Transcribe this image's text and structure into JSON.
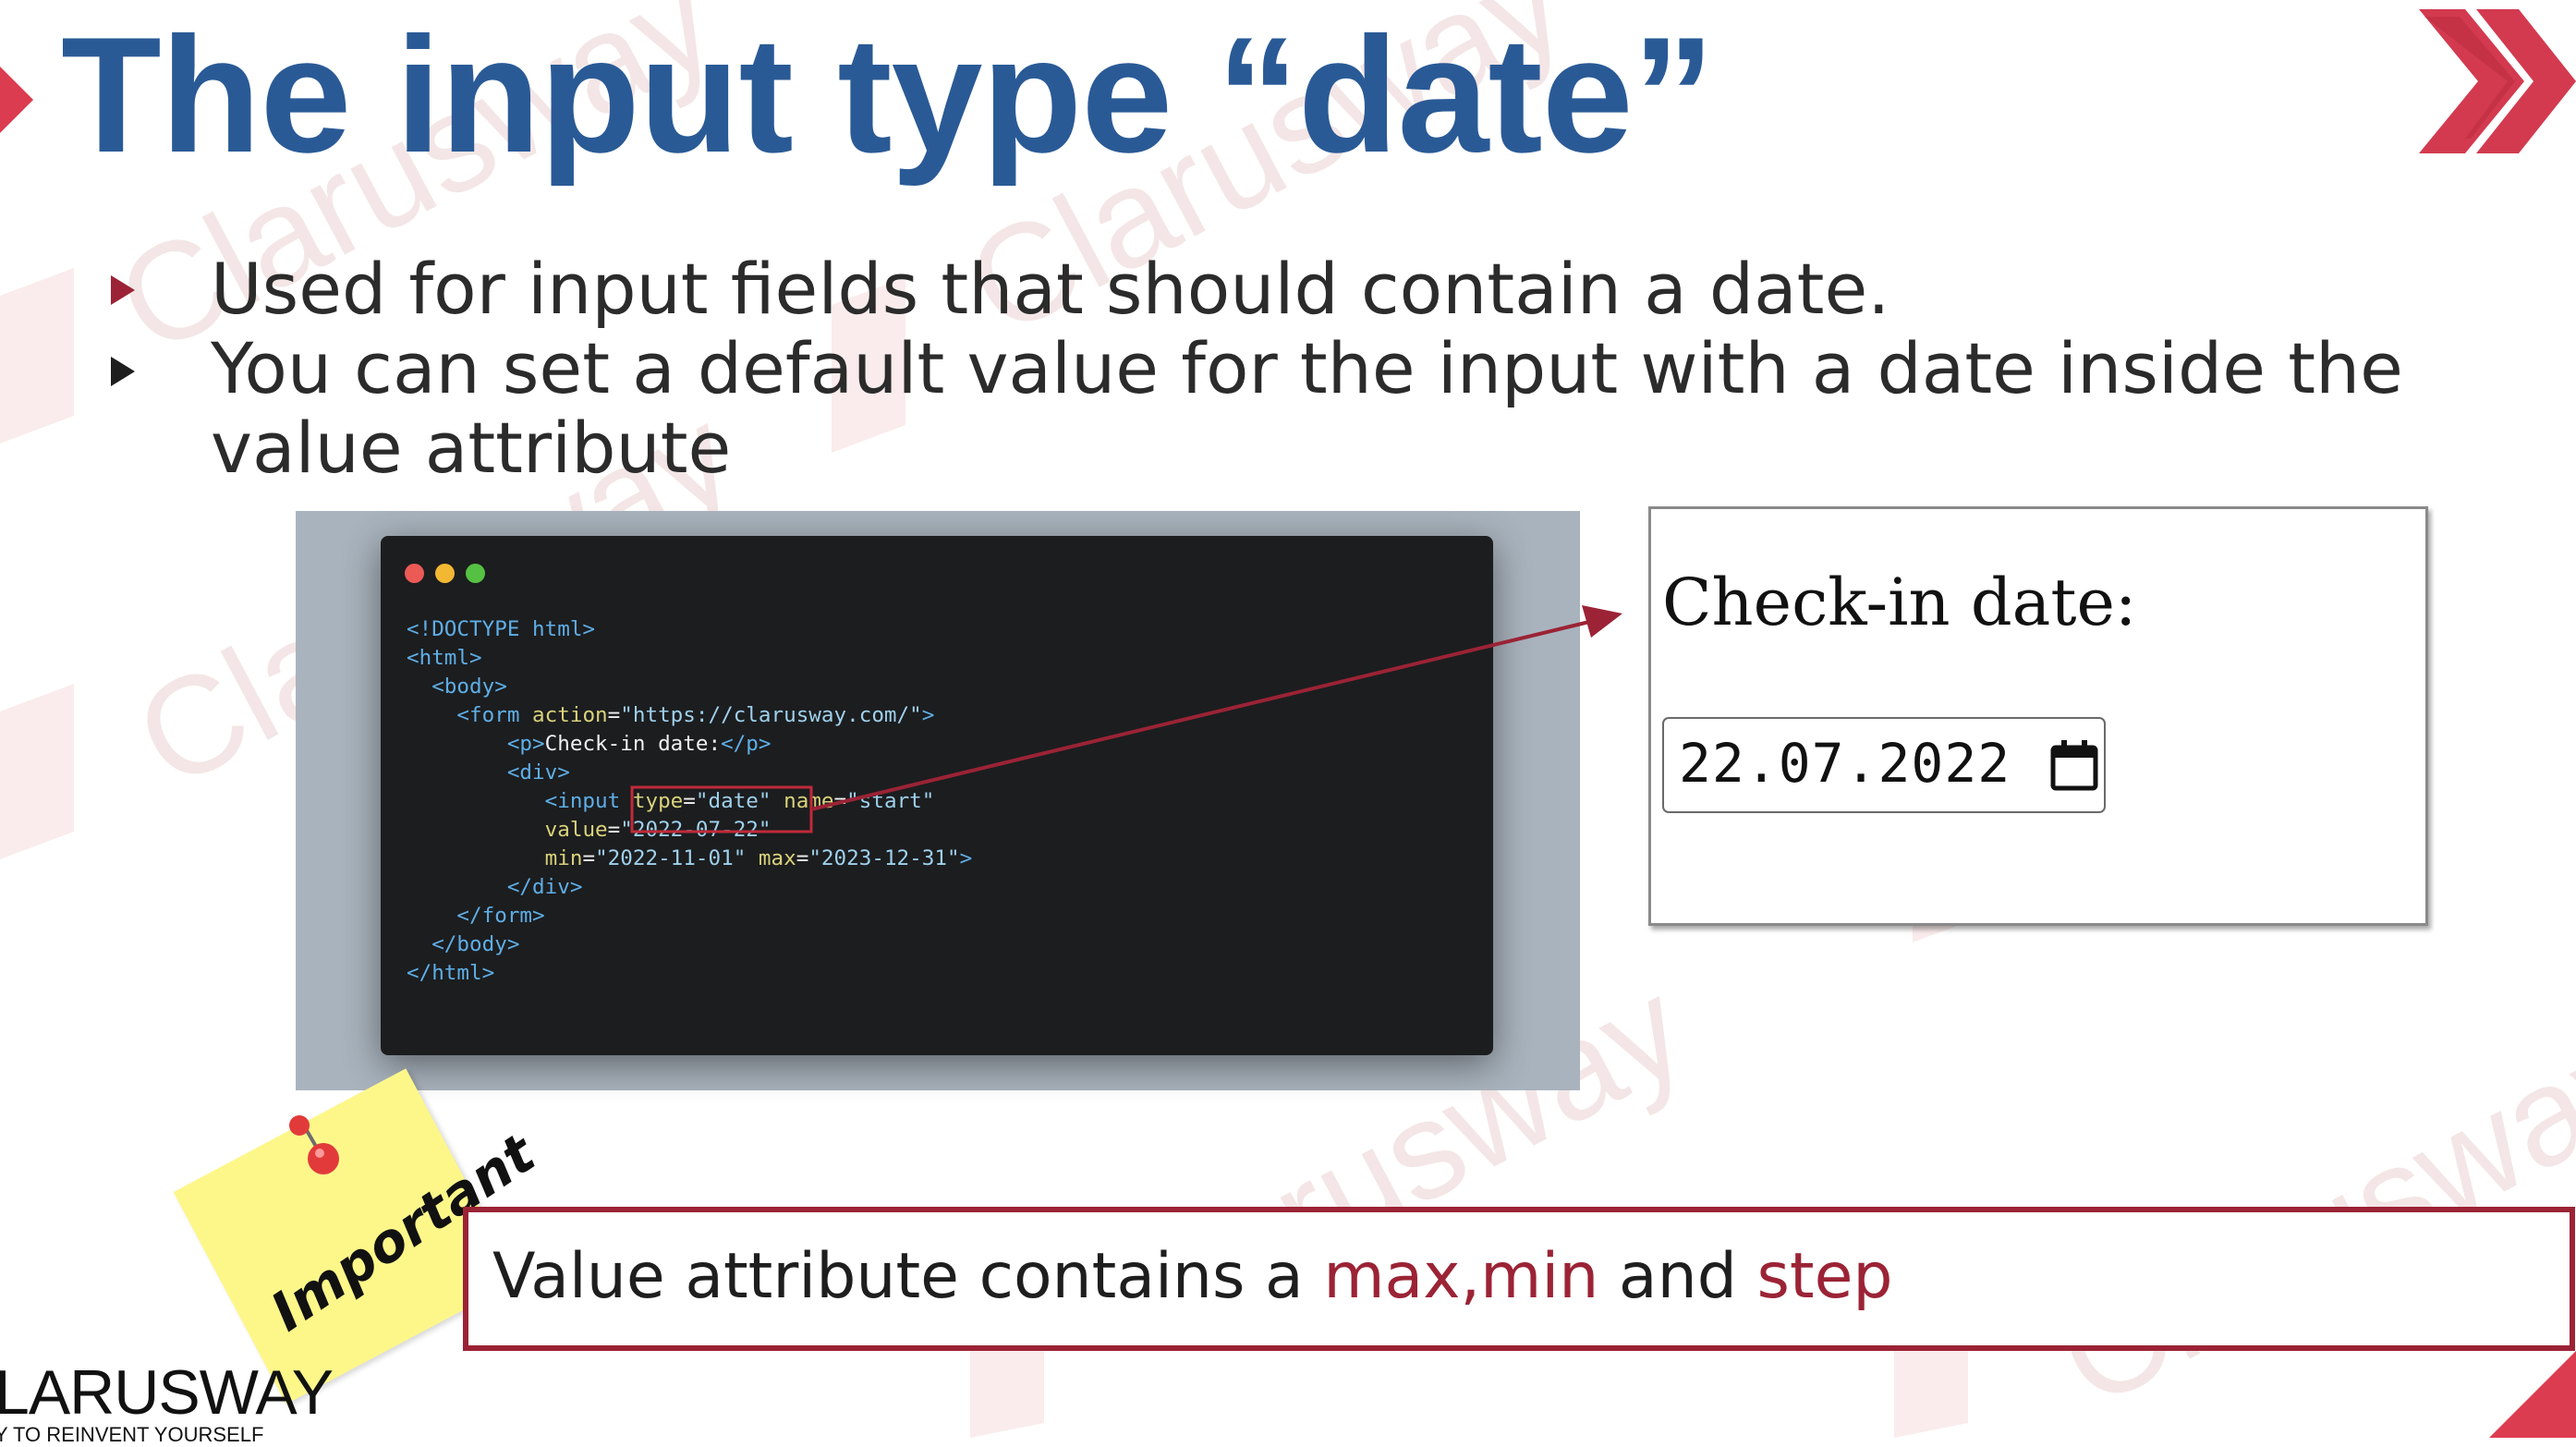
{
  "slide": {
    "title": "The input type “date”",
    "bullets": [
      {
        "lines": [
          "Used for input fields that should contain a date."
        ]
      },
      {
        "lines": [
          "You can set a default value for the input with a date inside the",
          "value attribute"
        ]
      }
    ],
    "watermark": "Clarusway"
  },
  "code_window": {
    "lines": [
      [
        "<!DOCTYPE html>"
      ],
      [
        "<html>"
      ],
      [
        "  <body>"
      ],
      [
        "    <form ",
        "action",
        "=",
        "\"https://clarusway.com/\"",
        ">"
      ],
      [
        "        <p>",
        "Check-in date:",
        "</p>"
      ],
      [
        "        <div>"
      ],
      [
        "           <input ",
        "type",
        "=",
        "\"date\"",
        " ",
        "name",
        "=",
        "\"start\""
      ],
      [
        "           ",
        "value",
        "=",
        "\"2022-07-22\""
      ],
      [
        "           ",
        "min",
        "=",
        "\"2022-11-01\"",
        " ",
        "max",
        "=",
        "\"2023-12-31\"",
        ">"
      ],
      [
        "        </div>"
      ],
      [
        "    </form>"
      ],
      [
        "  </body>"
      ],
      [
        "</html>"
      ]
    ]
  },
  "output_preview": {
    "label": "Check-in date:",
    "input_value": "22.07.2022"
  },
  "note": {
    "sticky_label": "Important",
    "text_start": "Value attribute contains a ",
    "text_red1": "max,min",
    "text_mid": " and ",
    "text_red2": "step"
  },
  "branding": {
    "logo": "LARUSWAY",
    "tagline": "Y TO REINVENT YOURSELF"
  },
  "colors": {
    "title_blue": "#2a5a96",
    "accent_red": "#9b2335",
    "arrow_red": "#dc3c50",
    "sticky_yellow": "#fdf78a"
  }
}
